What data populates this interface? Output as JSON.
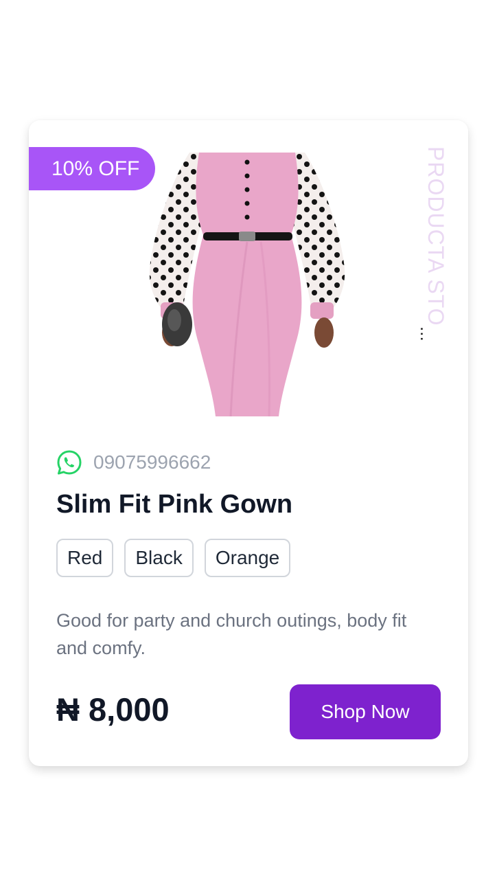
{
  "product": {
    "discount_badge": "10% OFF",
    "store_name": "PRODUCTA STO",
    "store_ellipsis": "...",
    "phone": "09075996662",
    "title": "Slim Fit Pink Gown",
    "colors": [
      "Red",
      "Black",
      "Orange"
    ],
    "description": "Good for party and church outings, body fit and comfy.",
    "price": "₦ 8,000",
    "shop_button_label": "Shop Now",
    "image_alt": "Pink slim fit gown with polka dot sheer sleeves"
  },
  "icons": {
    "contact": "whatsapp-icon"
  },
  "theme": {
    "badge_bg": "#a855f7",
    "button_bg": "#7e22ce",
    "store_text": "#ead8f3",
    "whatsapp_green": "#25d366",
    "dress_pink": "#e9a6c9"
  }
}
